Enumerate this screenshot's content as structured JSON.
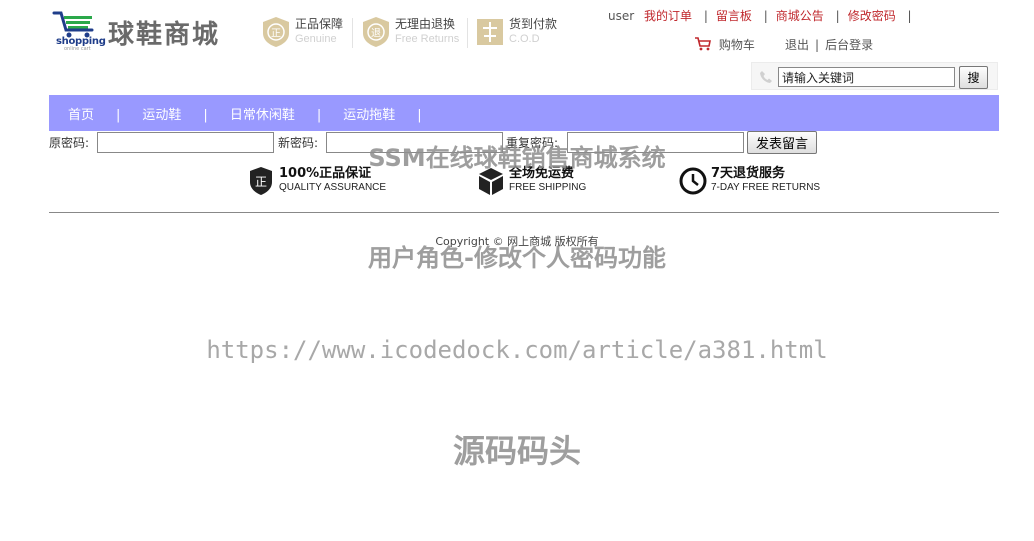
{
  "brand": {
    "logo_word": "shopping",
    "logo_sub": "online cart",
    "name": "球鞋商城"
  },
  "guarantees": [
    {
      "icon": "genuine-badge-icon",
      "main": "正品保障",
      "sub": "Genuine"
    },
    {
      "icon": "free-returns-badge-icon",
      "main": "无理由退换",
      "sub": "Free Returns"
    },
    {
      "icon": "cod-badge-icon",
      "main": "货到付款",
      "sub": "C.O.D"
    }
  ],
  "top_links": {
    "user": "user",
    "orders": "我的订单",
    "guestbook": "留言板",
    "announcements": "商城公告",
    "change_password": "修改密码",
    "sep": "|"
  },
  "account_links": {
    "cart": "购物车",
    "logout": "退出",
    "admin_login": "后台登录",
    "sep": "|"
  },
  "search": {
    "value": "请输入关键词",
    "button": "搜"
  },
  "nav": {
    "items": [
      "首页",
      "运动鞋",
      "日常休闲鞋",
      "运动拖鞋"
    ],
    "sep": "|"
  },
  "password_form": {
    "old_label": "原密码:",
    "new_label": "新密码:",
    "repeat_label": "重复密码:",
    "submit": "发表留言"
  },
  "services": [
    {
      "icon": "shield-genuine-icon",
      "main": "100%正品保证",
      "sub": "QUALITY ASSURANCE"
    },
    {
      "icon": "package-box-icon",
      "main": "全场免运费",
      "sub": "FREE SHIPPING"
    },
    {
      "icon": "clock-icon",
      "main": "7天退货服务",
      "sub": "7-DAY FREE RETURNS"
    }
  ],
  "footer": {
    "copyright": "Copyright © 网上商城 版权所有"
  },
  "watermark": {
    "line1": "SSM在线球鞋销售商城系统",
    "line2": "用户角色-修改个人密码功能",
    "line3": "https://www.icodedock.com/article/a381.html",
    "line4": "源码码头"
  },
  "colors": {
    "nav_bg": "#9999ff",
    "link_red": "#c0282d",
    "badge_gold": "#d9c9a0"
  }
}
